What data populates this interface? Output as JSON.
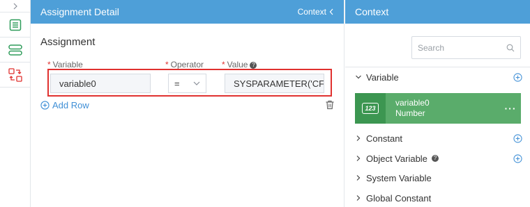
{
  "rail": {
    "items": [
      {
        "icon": "chevron-right-icon"
      },
      {
        "icon": "list-icon"
      },
      {
        "icon": "storage-icon"
      },
      {
        "icon": "transform-icon"
      }
    ],
    "active_color": "#2e9c5a"
  },
  "assignment": {
    "header_title": "Assignment Detail",
    "context_toggle": "Context",
    "section_title": "Assignment",
    "columns": {
      "variable": "Variable",
      "operator": "Operator",
      "value": "Value"
    },
    "row": {
      "variable": "variable0",
      "operator": "=",
      "value": "SYSPARAMETER('CF"
    },
    "add_row": "Add Row"
  },
  "context": {
    "header_title": "Context",
    "search_placeholder": "Search",
    "sections": {
      "variable": "Variable",
      "constant": "Constant",
      "object_variable": "Object Variable",
      "system_variable": "System Variable",
      "global_constant": "Global Constant"
    },
    "variable_card": {
      "name": "variable0",
      "type": "Number",
      "icon_text": "123",
      "more": "···"
    }
  },
  "colors": {
    "header_blue": "#4e9fd8",
    "accent_blue": "#3f8fd6",
    "required_red": "#e0312f",
    "card_green": "#5aac6b",
    "card_green_dark": "#3c9651"
  }
}
